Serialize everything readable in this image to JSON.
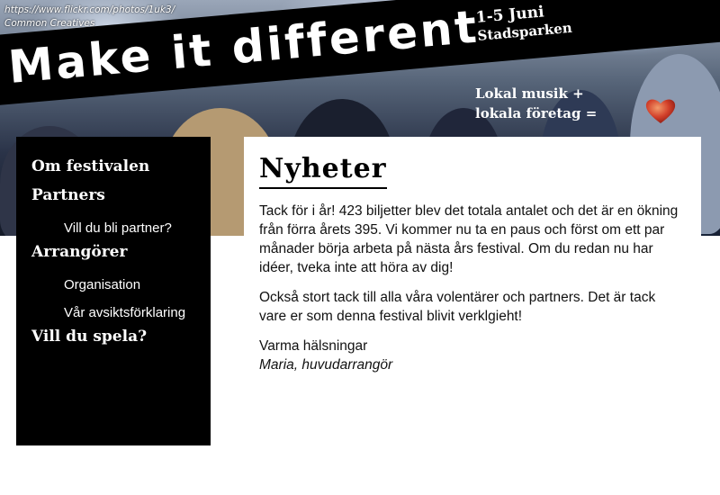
{
  "photo_credit": {
    "url": "https://www.flickr.com/photos/1uk3/",
    "license": "Common Creatives"
  },
  "banner": {
    "title": "Make it different",
    "dates": "1-5 Juni",
    "place": "Stadsparken",
    "tagline_line1": "Lokal musik +",
    "tagline_line2": "lokala företag ="
  },
  "sidebar": {
    "items": [
      {
        "label": "Om festivalen",
        "level": 1
      },
      {
        "label": "Partners",
        "level": 1
      },
      {
        "label": "Vill du bli partner?",
        "level": 2
      },
      {
        "label": "Arrangörer",
        "level": 1
      },
      {
        "label": "Organisation",
        "level": 2
      },
      {
        "label": "Vår avsiktsförklaring",
        "level": 2
      },
      {
        "label": "Vill du spela?",
        "level": 1
      }
    ]
  },
  "news": {
    "title": "Nyheter",
    "paragraph1": "Tack för i år! 423 biljetter blev det totala antalet och det är en ökning från förra årets 395. Vi kommer nu ta en paus och först om ett par månader börja arbeta på nästa års festival. Om du redan nu har idéer, tveka inte att höra av dig!",
    "paragraph2": "Också stort tack till alla våra volentärer och partners. Det är tack vare er som denna festival blivit verklgieht!",
    "greeting": "Varma hälsningar",
    "signature": "Maria, huvudarrangör"
  },
  "colors": {
    "banner_bg": "#000000",
    "sidebar_bg": "#000000",
    "heart": "#d2402a"
  }
}
